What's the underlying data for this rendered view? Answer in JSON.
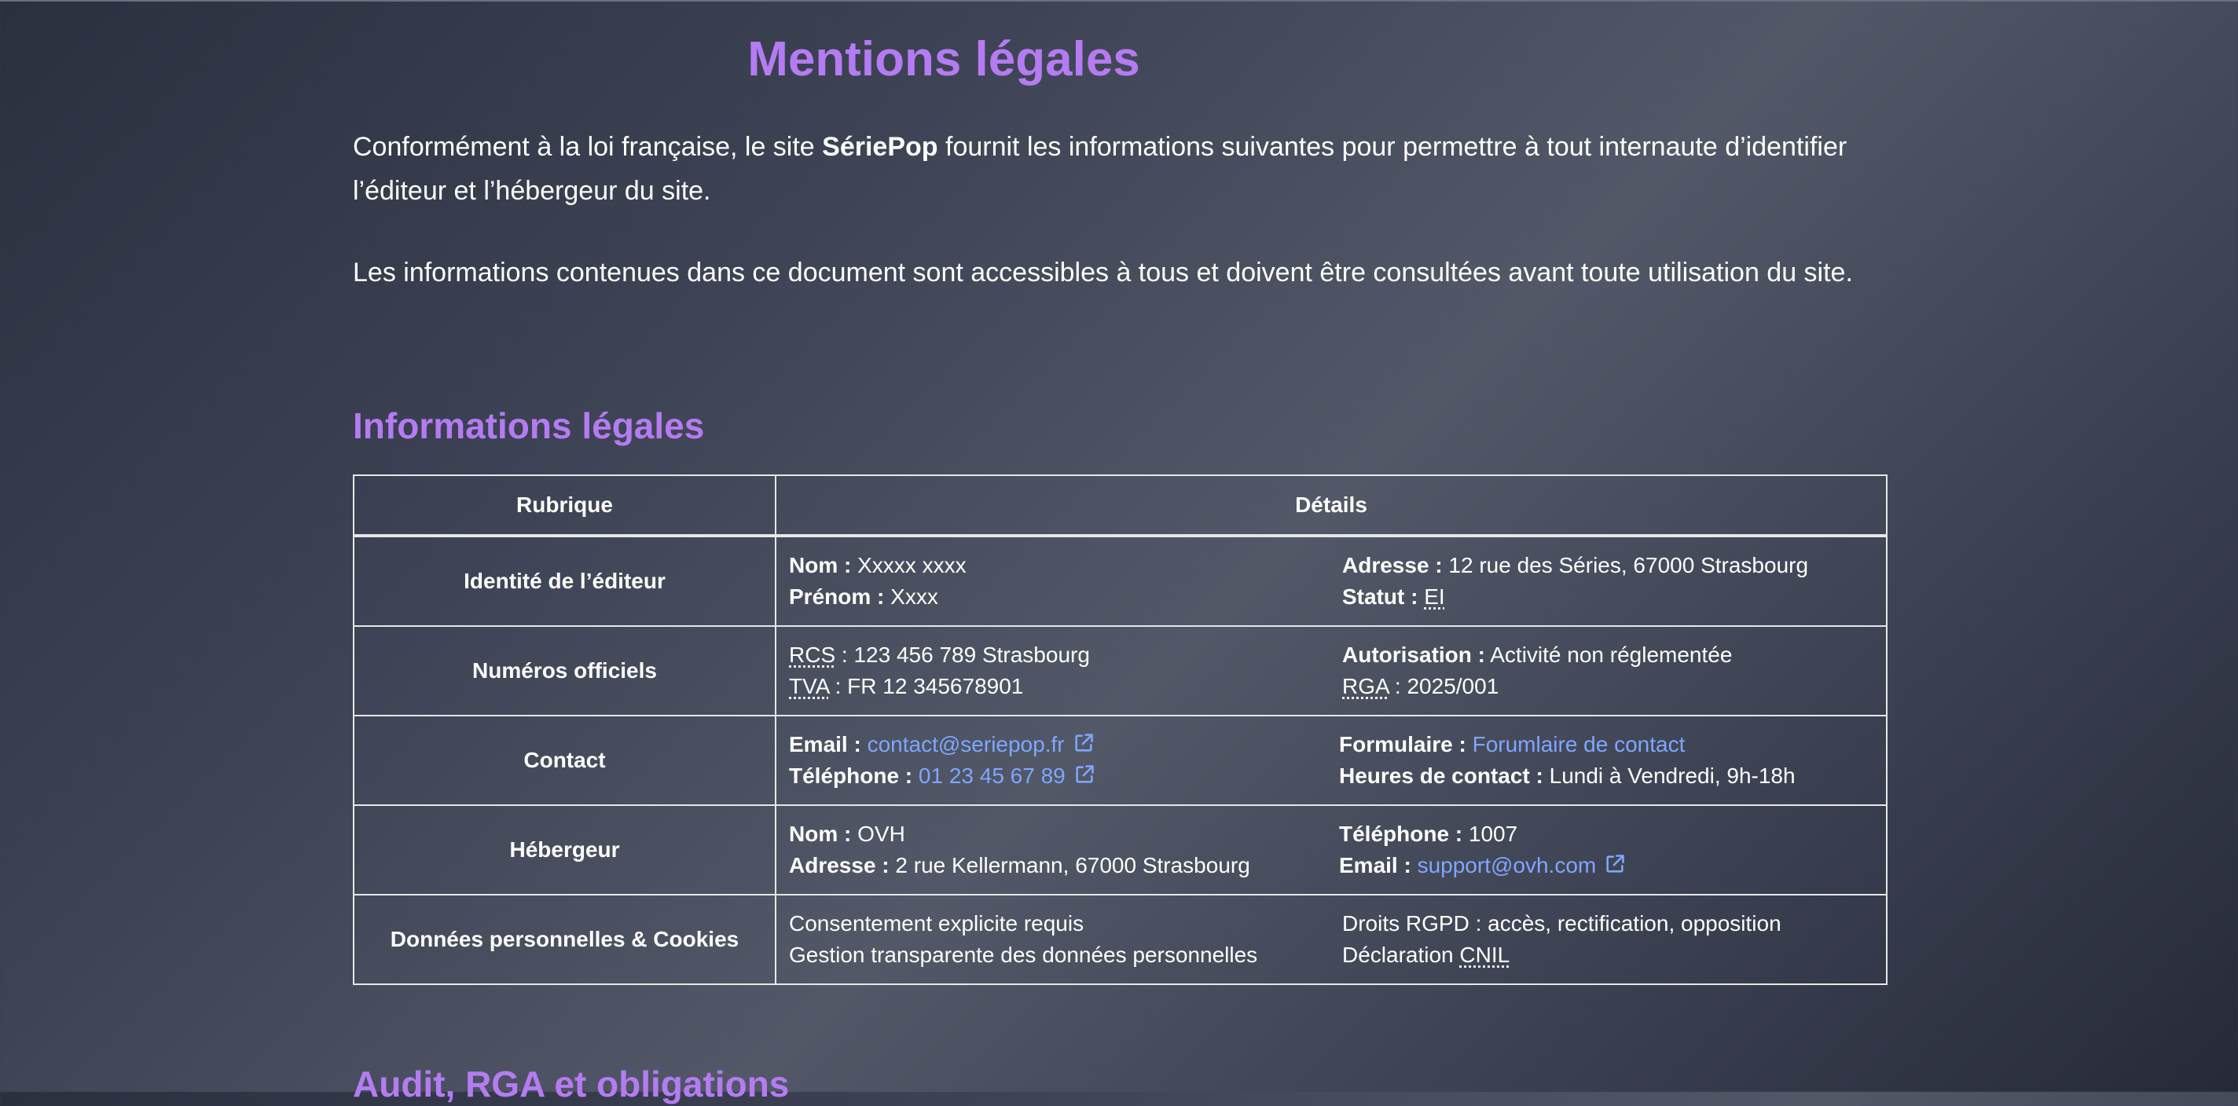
{
  "page": {
    "title": "Mentions légales"
  },
  "intro": {
    "p1_before": "Conformément à la loi française, le site ",
    "p1_brand": "SériePop",
    "p1_after": " fournit les informations suivantes pour permettre à tout internaute d’identifier l’éditeur et l’hébergeur du site.",
    "p2": "Les informations contenues dans ce document sont accessibles à tous et doivent être consultées avant toute utilisation du site."
  },
  "sections": {
    "legal_info": "Informations légales",
    "audit": "Audit, RGA et obligations"
  },
  "table": {
    "headers": {
      "rubrique": "Rubrique",
      "details": "Détails"
    },
    "rows": [
      {
        "rubric": "Identité de l’éditeur",
        "left": [
          {
            "label": "Nom :",
            "value": "Xxxxx xxxx"
          },
          {
            "label": "Prénom :",
            "value": "Xxxx"
          }
        ],
        "right": [
          {
            "label": "Adresse :",
            "value": "12 rue des Séries, 67000 Strasbourg"
          },
          {
            "label": "Statut :",
            "value": "EI"
          }
        ]
      },
      {
        "rubric": "Numéros officiels",
        "left": [
          {
            "abbr": "RCS",
            "value": ": 123 456 789 Strasbourg"
          },
          {
            "abbr": "TVA",
            "value": ": FR 12 345678901"
          }
        ],
        "right": [
          {
            "label": "Autorisation :",
            "value": "Activité non réglementée"
          },
          {
            "abbr": "RGA",
            "value": ": 2025/001"
          }
        ]
      },
      {
        "rubric": "Contact",
        "left": [
          {
            "label": "Email :",
            "link": "contact@seriepop.fr",
            "icon": "external-link-icon"
          },
          {
            "label": "Téléphone :",
            "link": "01 23 45 67 89",
            "icon": "external-link-icon"
          }
        ],
        "right": [
          {
            "label": "Formulaire :",
            "link": "Forumlaire de contact"
          },
          {
            "label": "Heures de contact :",
            "value": "Lundi à Vendredi, 9h-18h"
          }
        ]
      },
      {
        "rubric": "Hébergeur",
        "left": [
          {
            "label": "Nom :",
            "value": "OVH"
          },
          {
            "label": "Adresse :",
            "value": "2 rue Kellermann, 67000 Strasbourg"
          }
        ],
        "right": [
          {
            "label": "Téléphone :",
            "value": "1007"
          },
          {
            "label": "Email :",
            "link": "support@ovh.com",
            "icon": "external-link-icon"
          }
        ]
      },
      {
        "rubric": "Données personnelles & Cookies",
        "left": [
          {
            "value": "Consentement explicite requis"
          },
          {
            "value": "Gestion transparente des données personnelles"
          }
        ],
        "right": [
          {
            "value": "Droits RGPD : accès, rectification, opposition"
          },
          {
            "prefix": "Déclaration",
            "abbr": "CNIL"
          }
        ]
      }
    ]
  },
  "colors": {
    "accent": "#b57bf2",
    "link": "#7fa6ff",
    "text": "#ffffff"
  }
}
